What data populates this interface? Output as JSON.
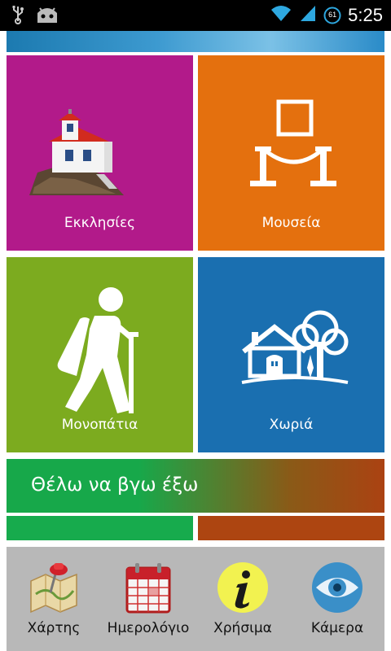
{
  "status_bar": {
    "time": "5:25",
    "battery_level": "61",
    "icons": [
      "usb-icon",
      "android-debug-icon",
      "wifi-icon",
      "signal-icon",
      "battery-icon"
    ]
  },
  "tiles": [
    {
      "label": "Εκκλησίες",
      "color": "#b21a8a",
      "icon": "church-icon"
    },
    {
      "label": "Μουσεία",
      "color": "#e4700e",
      "icon": "museum-exhibit-icon"
    },
    {
      "label": "Μονοπάτια",
      "color": "#7cab1f",
      "icon": "hiker-icon"
    },
    {
      "label": "Χωριά",
      "color": "#1a6fb0",
      "icon": "village-house-icon"
    }
  ],
  "go_out": {
    "label": "Θέλω να βγω έξω"
  },
  "bottom_nav": [
    {
      "label": "Χάρτης",
      "icon": "map-pin-icon"
    },
    {
      "label": "Ημερολόγιο",
      "icon": "calendar-icon"
    },
    {
      "label": "Χρήσιμα",
      "icon": "info-icon"
    },
    {
      "label": "Κάμερα",
      "icon": "eye-icon"
    }
  ]
}
